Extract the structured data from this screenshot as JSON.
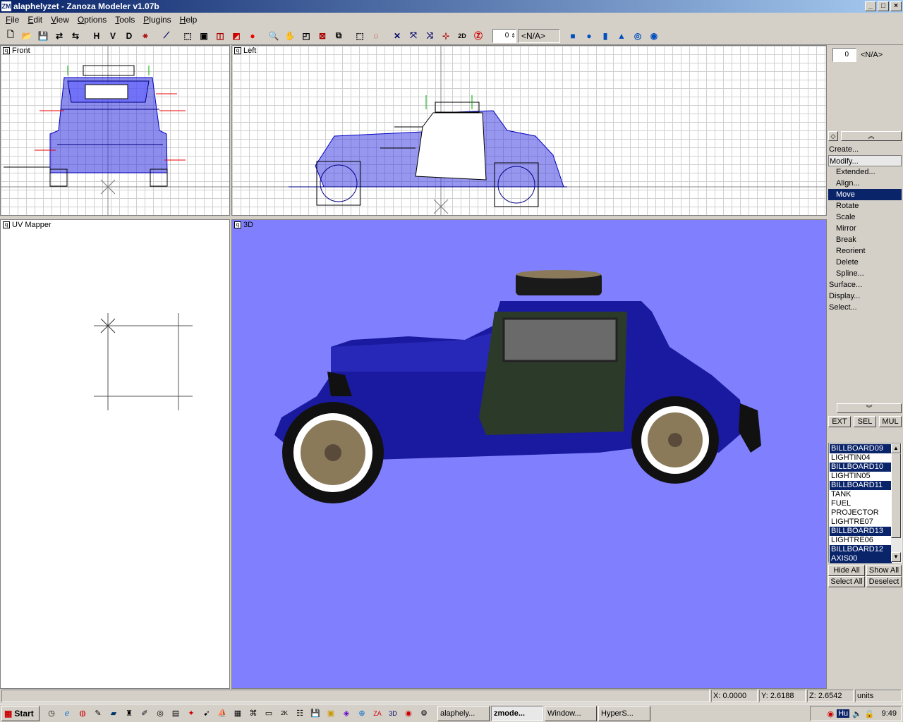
{
  "window": {
    "title": "alaphelyzet - Zanoza Modeler v1.07b",
    "controls": [
      "_",
      "□",
      "×"
    ]
  },
  "menu": [
    "File",
    "Edit",
    "View",
    "Options",
    "Tools",
    "Plugins",
    "Help"
  ],
  "toolbar": {
    "letters": [
      "H",
      "V",
      "D"
    ],
    "spin_value": "0",
    "na_value": "<N/A>"
  },
  "viewports": {
    "front": "Front",
    "left": "Left",
    "uv": "UV Mapper",
    "view3d": "3D"
  },
  "panel": {
    "spin_value": "0",
    "na_value": "<N/A>",
    "menu": [
      {
        "label": "Create...",
        "level": "top"
      },
      {
        "label": "Modify...",
        "level": "modify"
      },
      {
        "label": "Extended...",
        "level": "sub"
      },
      {
        "label": "Align...",
        "level": "sub"
      },
      {
        "label": "Move",
        "level": "selected"
      },
      {
        "label": "Rotate",
        "level": "sub"
      },
      {
        "label": "Scale",
        "level": "sub"
      },
      {
        "label": "Mirror",
        "level": "sub"
      },
      {
        "label": "Break",
        "level": "sub"
      },
      {
        "label": "Reorient",
        "level": "sub"
      },
      {
        "label": "Delete",
        "level": "sub"
      },
      {
        "label": "Spline...",
        "level": "sub"
      },
      {
        "label": "Surface...",
        "level": "top"
      },
      {
        "label": "Display...",
        "level": "top"
      },
      {
        "label": "Select...",
        "level": "top"
      }
    ],
    "mode_buttons": [
      "EXT",
      "SEL",
      "MUL"
    ],
    "objects": [
      {
        "name": "BILLBOARD09",
        "selected": true
      },
      {
        "name": "LIGHTIN04",
        "selected": false
      },
      {
        "name": "BILLBOARD10",
        "selected": true
      },
      {
        "name": "LIGHTIN05",
        "selected": false
      },
      {
        "name": "BILLBOARD11",
        "selected": true
      },
      {
        "name": "TANK",
        "selected": false
      },
      {
        "name": "FUEL",
        "selected": false
      },
      {
        "name": "PROJECTOR",
        "selected": false
      },
      {
        "name": "LIGHTRE07",
        "selected": false
      },
      {
        "name": "BILLBOARD13",
        "selected": true
      },
      {
        "name": "LIGHTRE06",
        "selected": false
      },
      {
        "name": "BILLBOARD12",
        "selected": true
      },
      {
        "name": "AXIS00",
        "selected": true
      }
    ],
    "list_buttons": {
      "hide_all": "Hide All",
      "show_all": "Show All",
      "select_all": "Select All",
      "deselect": "Deselect"
    }
  },
  "status": {
    "x": "X: 0.0000",
    "y": "Y: 2.6188",
    "z": "Z: 2.6542",
    "units": "units"
  },
  "taskbar": {
    "start": "Start",
    "tasks": [
      {
        "label": "alaphely...",
        "active": false
      },
      {
        "label": "zmode...",
        "active": true
      },
      {
        "label": "Window...",
        "active": false
      },
      {
        "label": "HyperS...",
        "active": false
      }
    ],
    "tray_lang": "Hu",
    "clock": "9:49"
  },
  "colors": {
    "car_body": "#1a1aa0",
    "view3d_bg": "#8080ff",
    "title_start": "#0a246a",
    "title_end": "#a6caf0"
  }
}
